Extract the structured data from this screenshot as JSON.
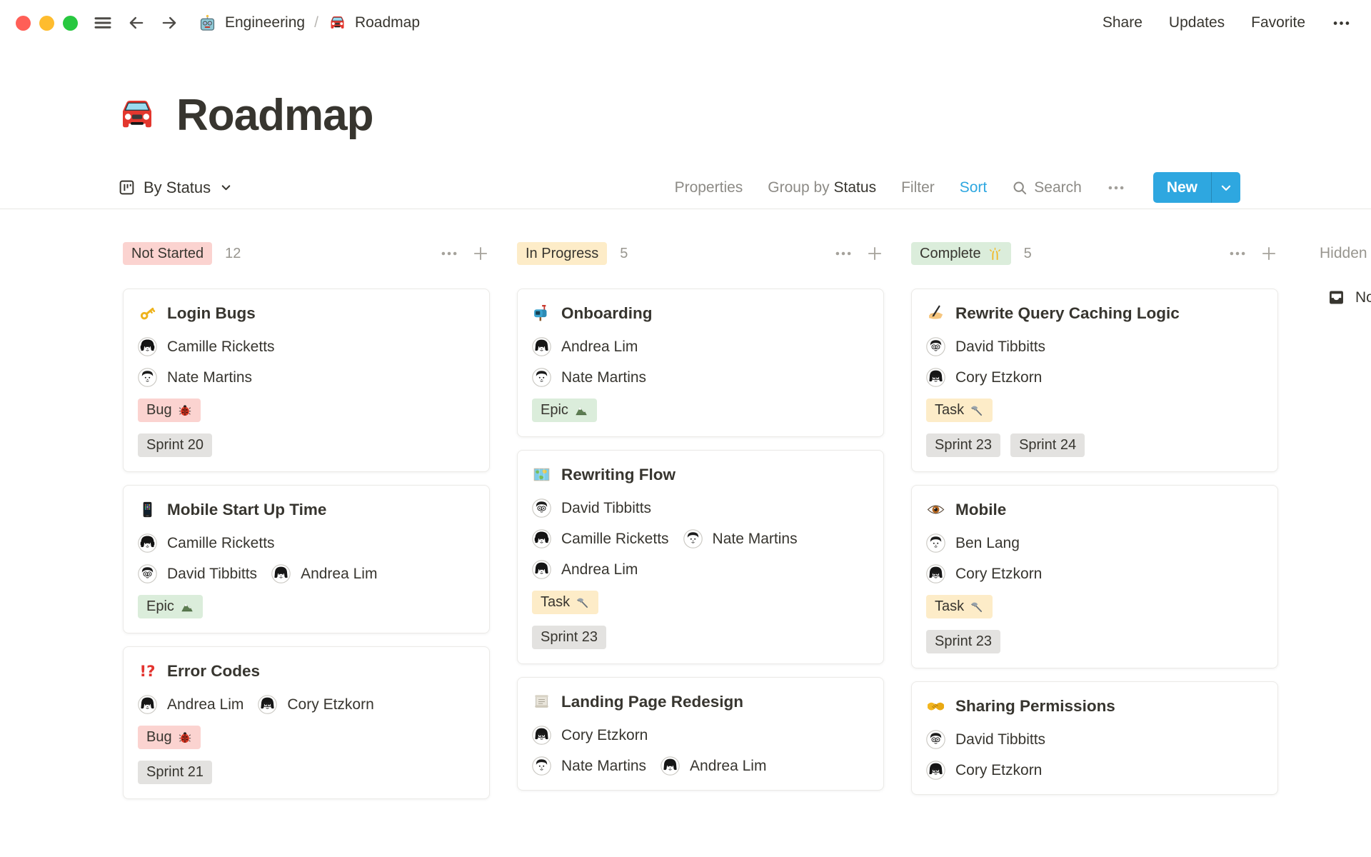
{
  "topbar": {
    "breadcrumb": [
      {
        "icon": "robot-icon",
        "label": "Engineering"
      },
      {
        "icon": "car-icon",
        "label": "Roadmap"
      }
    ],
    "breadcrumb_separator": "/",
    "actions": [
      "Share",
      "Updates",
      "Favorite"
    ]
  },
  "title": {
    "icon": "car-icon",
    "text": "Roadmap"
  },
  "toolbar": {
    "view_label": "By Status",
    "properties_label": "Properties",
    "group_by_prefix": "Group by",
    "group_by_value": "Status",
    "filter_label": "Filter",
    "sort_label": "Sort",
    "search_label": "Search",
    "new_label": "New"
  },
  "board": {
    "columns": [
      {
        "name": "Not Started",
        "count": "12",
        "color": "pink",
        "cards": [
          {
            "icon": "key-icon",
            "title": "Login Bugs",
            "people_rows": [
              [
                {
                  "name": "Camille Ricketts",
                  "avatar": "woman-headphones"
                }
              ],
              [
                {
                  "name": "Nate Martins",
                  "avatar": "man-short"
                }
              ]
            ],
            "tag_rows": [
              [
                {
                  "label": "Bug",
                  "icon": "beetle-icon",
                  "color": "pink"
                }
              ],
              [
                {
                  "label": "Sprint 20",
                  "color": "gray"
                }
              ]
            ]
          },
          {
            "icon": "mobile-phone-icon",
            "title": "Mobile Start Up Time",
            "people_rows": [
              [
                {
                  "name": "Camille Ricketts",
                  "avatar": "woman-headphones"
                }
              ],
              [
                {
                  "name": "David Tibbitts",
                  "avatar": "man-glasses"
                },
                {
                  "name": "Andrea Lim",
                  "avatar": "woman-bob"
                }
              ]
            ],
            "tag_rows": [
              [
                {
                  "label": "Epic",
                  "icon": "mountain-icon",
                  "color": "green"
                }
              ]
            ]
          },
          {
            "icon": "interrobang-icon",
            "title": "Error Codes",
            "people_rows": [
              [
                {
                  "name": "Andrea Lim",
                  "avatar": "woman-bob"
                },
                {
                  "name": "Cory Etzkorn",
                  "avatar": "long-hair-glasses"
                }
              ]
            ],
            "tag_rows": [
              [
                {
                  "label": "Bug",
                  "icon": "beetle-icon",
                  "color": "pink"
                }
              ],
              [
                {
                  "label": "Sprint 21",
                  "color": "gray"
                }
              ]
            ]
          }
        ]
      },
      {
        "name": "In Progress",
        "count": "5",
        "color": "yellow",
        "cards": [
          {
            "icon": "mailbox-icon",
            "title": "Onboarding",
            "people_rows": [
              [
                {
                  "name": "Andrea Lim",
                  "avatar": "woman-bob"
                }
              ],
              [
                {
                  "name": "Nate Martins",
                  "avatar": "man-short"
                }
              ]
            ],
            "tag_rows": [
              [
                {
                  "label": "Epic",
                  "icon": "mountain-icon",
                  "color": "green"
                }
              ]
            ]
          },
          {
            "icon": "world-map-icon",
            "title": "Rewriting Flow",
            "people_rows": [
              [
                {
                  "name": "David Tibbitts",
                  "avatar": "man-glasses"
                }
              ],
              [
                {
                  "name": "Camille Ricketts",
                  "avatar": "woman-headphones"
                },
                {
                  "name": "Nate Martins",
                  "avatar": "man-short"
                }
              ],
              [
                {
                  "name": "Andrea Lim",
                  "avatar": "woman-bob"
                }
              ]
            ],
            "tag_rows": [
              [
                {
                  "label": "Task",
                  "icon": "hammer-icon",
                  "color": "yellow"
                }
              ],
              [
                {
                  "label": "Sprint 23",
                  "color": "gray"
                }
              ]
            ]
          },
          {
            "icon": "scroll-icon",
            "title": "Landing Page Redesign",
            "people_rows": [
              [
                {
                  "name": "Cory Etzkorn",
                  "avatar": "long-hair-glasses"
                }
              ],
              [
                {
                  "name": "Nate Martins",
                  "avatar": "man-short"
                },
                {
                  "name": "Andrea Lim",
                  "avatar": "woman-bob"
                }
              ]
            ],
            "tag_rows": []
          }
        ]
      },
      {
        "name": "Complete",
        "badge_icon": "raised-hands-icon",
        "count": "5",
        "color": "green",
        "cards": [
          {
            "icon": "writing-hand-icon",
            "title": "Rewrite Query Caching Logic",
            "people_rows": [
              [
                {
                  "name": "David Tibbitts",
                  "avatar": "man-glasses"
                }
              ],
              [
                {
                  "name": "Cory Etzkorn",
                  "avatar": "long-hair-glasses"
                }
              ]
            ],
            "tag_rows": [
              [
                {
                  "label": "Task",
                  "icon": "hammer-icon",
                  "color": "yellow"
                }
              ],
              [
                {
                  "label": "Sprint 23",
                  "color": "gray"
                },
                {
                  "label": "Sprint 24",
                  "color": "gray"
                }
              ]
            ]
          },
          {
            "icon": "eye-icon",
            "title": "Mobile",
            "people_rows": [
              [
                {
                  "name": "Ben Lang",
                  "avatar": "man-short"
                }
              ],
              [
                {
                  "name": "Cory Etzkorn",
                  "avatar": "long-hair-glasses"
                }
              ]
            ],
            "tag_rows": [
              [
                {
                  "label": "Task",
                  "icon": "hammer-icon",
                  "color": "yellow"
                }
              ],
              [
                {
                  "label": "Sprint 23",
                  "color": "gray"
                }
              ]
            ]
          },
          {
            "icon": "handshake-icon",
            "title": "Sharing Permissions",
            "people_rows": [
              [
                {
                  "name": "David Tibbitts",
                  "avatar": "man-glasses"
                }
              ],
              [
                {
                  "name": "Cory Etzkorn",
                  "avatar": "long-hair-glasses"
                }
              ]
            ],
            "tag_rows": []
          }
        ]
      }
    ],
    "hidden_label": "Hidden",
    "hidden_group": {
      "icon": "inbox-icon",
      "label": "No"
    }
  },
  "palette": {
    "accent_blue": "#2ea7e0",
    "badge_pink": "#fbd3d0",
    "badge_yellow": "#fdecc8",
    "badge_green": "#dbeddb",
    "badge_gray": "#e3e2e0",
    "traffic_red": "#ff5f57",
    "traffic_yellow": "#febc2e",
    "traffic_green": "#28c840"
  }
}
